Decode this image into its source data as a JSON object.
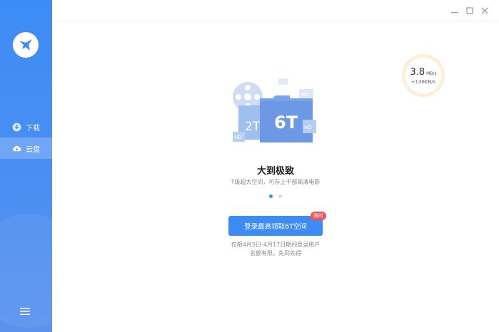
{
  "sidebar": {
    "logo_icon": "bird-logo-icon",
    "items": [
      {
        "label": "下载",
        "icon": "download-icon"
      },
      {
        "label": "云盘",
        "icon": "cloud-icon",
        "active": true
      }
    ],
    "menu_icon": "hamburger-menu-icon"
  },
  "window": {
    "controls": [
      "minimize-icon",
      "maximize-icon",
      "close-icon"
    ]
  },
  "speed": {
    "value": "3.8",
    "unit": "MB/s",
    "delta": "+136KB/s"
  },
  "promo": {
    "illustration": {
      "big_label": "6T",
      "small_label": "2T",
      "hd_label": "HD"
    },
    "headline": "大到极致",
    "subline": "T级超大空间，可存上千部高清电影",
    "carousel": {
      "count": 2,
      "active": 0
    },
    "button_label": "登录最高领取6T空间",
    "badge": "限时",
    "note_line1": "仅限4月5日-4月17日期间登录用户",
    "note_line2": "名额有限，先到先得"
  },
  "colors": {
    "accent": "#3d8cf5",
    "badge": "#f0525a"
  }
}
